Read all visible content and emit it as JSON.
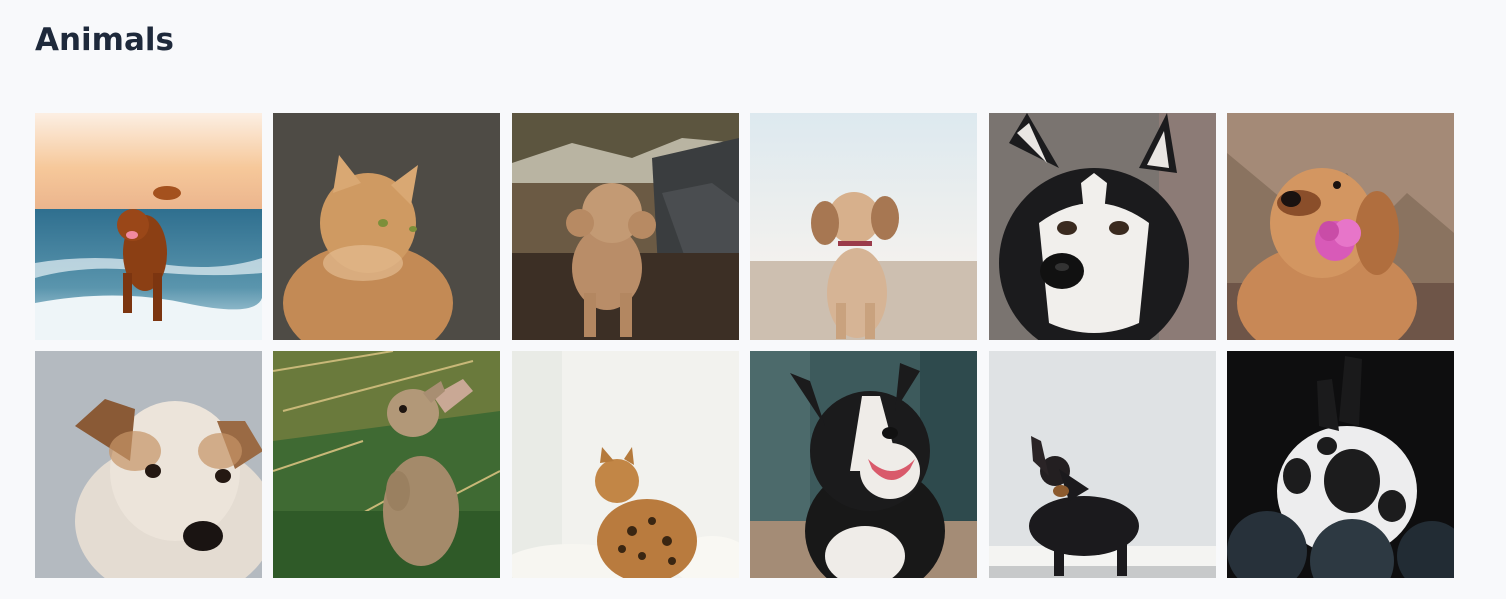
{
  "page": {
    "title": "Animals"
  },
  "gallery": {
    "items": [
      {
        "subject": "dog-running-on-beach"
      },
      {
        "subject": "ginger-long-haired-cat"
      },
      {
        "subject": "poodle-by-rock-wall"
      },
      {
        "subject": "spaniel-on-sand"
      },
      {
        "subject": "husky-face"
      },
      {
        "subject": "golden-retriever-with-flower"
      },
      {
        "subject": "jack-russell-portrait"
      },
      {
        "subject": "rabbit-standing-in-grass"
      },
      {
        "subject": "bengal-cat-sitting"
      },
      {
        "subject": "border-collie-smiling"
      },
      {
        "subject": "dachshund-in-white-room"
      },
      {
        "subject": "spotted-rabbit-on-dark-balls"
      }
    ]
  }
}
